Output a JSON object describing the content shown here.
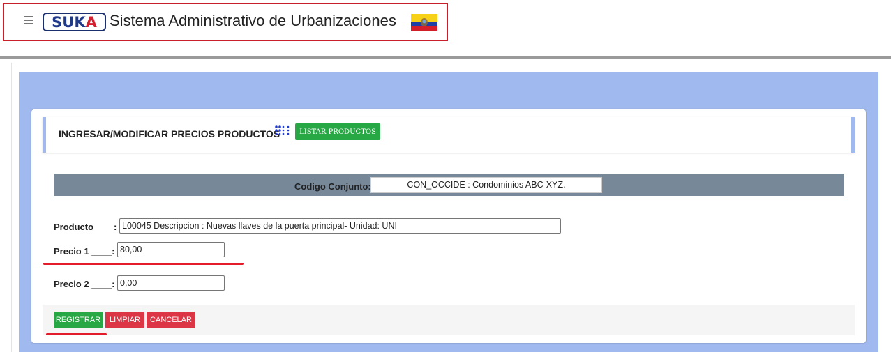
{
  "header": {
    "logo_text_1": "SUKA",
    "title": "Sistema Administrativo de Urbanizaciones",
    "flag_icon": "ecuador-flag-icon",
    "menu_icon": "hamburger-menu-icon"
  },
  "page": {
    "section_title": "INGRESAR/MODIFICAR PRECIOS PRODUCTOS",
    "list_icon": "dots-grid-icon",
    "list_button_label": "LISTAR PRODUCTOS"
  },
  "form": {
    "code_label": "Codigo Conjunto:",
    "code_value": "CON_OCCIDE : Condominios ABC-XYZ.",
    "product_label": "Producto____:",
    "product_value": "L00045 Descripcion : Nuevas llaves de la puerta principal- Unidad: UNI",
    "price1_label": "Precio 1 ____:",
    "price1_value": "80,00",
    "price2_label": "Precio 2 ____:",
    "price2_value": "0,00"
  },
  "actions": {
    "register_label": "REGISTRAR",
    "clear_label": "LIMPIAR",
    "cancel_label": "CANCELAR"
  },
  "colors": {
    "accent_blue": "#a0b9ee",
    "bar_gray": "#778899",
    "success": "#28a745",
    "danger": "#dc3545",
    "highlight_red": "#e21c2a"
  }
}
